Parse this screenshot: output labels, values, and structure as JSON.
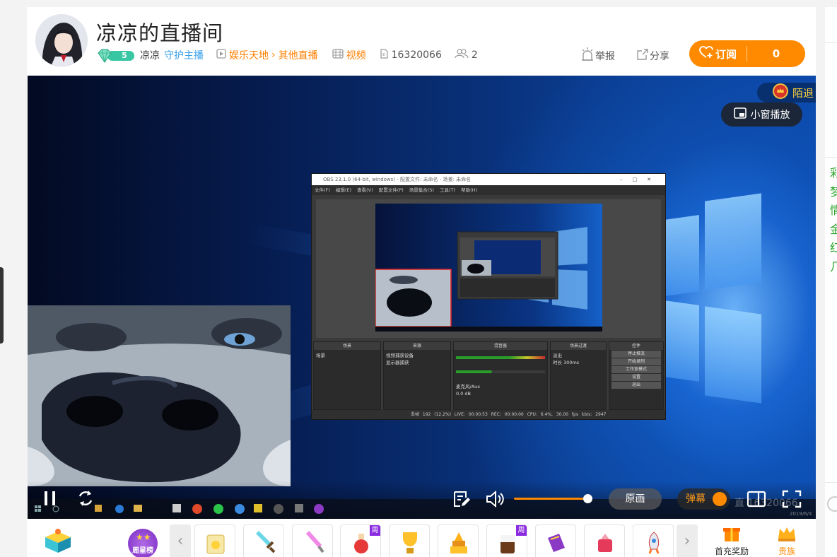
{
  "header": {
    "room_title": "凉凉的直播间",
    "level": "5",
    "host_name": "凉凉",
    "guard_link": "守护主播",
    "category": "娱乐天地",
    "subcategory": "其他直播",
    "video_link": "视频",
    "room_id": "16320066",
    "fans_count": "2",
    "report_label": "举报",
    "share_label": "分享",
    "subscribe_label": "订阅",
    "subscribe_count": "0"
  },
  "player": {
    "badge_text": "陌退",
    "pip_label": "小窗播放",
    "original_label": "原画",
    "danmaku_label": "弹幕",
    "watermark_text": "直",
    "watermark_id": "16320066",
    "watermark_date": "2019/6/4",
    "volume_level": 0.95
  },
  "obs": {
    "title": "OBS 23.1.0 (64-bit, windows) - 配置文件: 未命名 - 场景: 未命名",
    "menu": "文件(F) 编辑(E) 查看(V) 配置文件(P) 场景集合(S) 工具(T) 帮助(H)",
    "panels": [
      {
        "header": "场景",
        "items": [
          "场景"
        ]
      },
      {
        "header": "来源",
        "items": [
          "视频捕获设备",
          "显示器捕获"
        ]
      },
      {
        "header": "混音器",
        "items": [
          "麦克风/Aux",
          "0.0 dB"
        ]
      },
      {
        "header": "场景过渡",
        "items": [
          "淡出",
          "时长 300ms"
        ]
      },
      {
        "header": "控件",
        "items": [
          "停止推流",
          "开始录制",
          "工作室模式",
          "设置",
          "退出"
        ]
      }
    ],
    "status": "丢帧 192 (12.2%)  LIVE: 00:00:53  REC: 00:00:00  CPU: 6.4%, 30.00 fps  kb/s: 2947"
  },
  "gifts": {
    "weekly_rank_label": "周星榜",
    "weekly_tag": "周",
    "right_items": [
      "首充奖励",
      "贵族"
    ]
  },
  "colors": {
    "accent": "#ff8a00",
    "guard_blue": "#3aa0e8",
    "level_green": "#39c6a3",
    "chat_green": "#28a428"
  },
  "right_column": {
    "chat_chars": [
      "彩",
      "梦",
      "情",
      "金",
      "红",
      "几"
    ]
  }
}
